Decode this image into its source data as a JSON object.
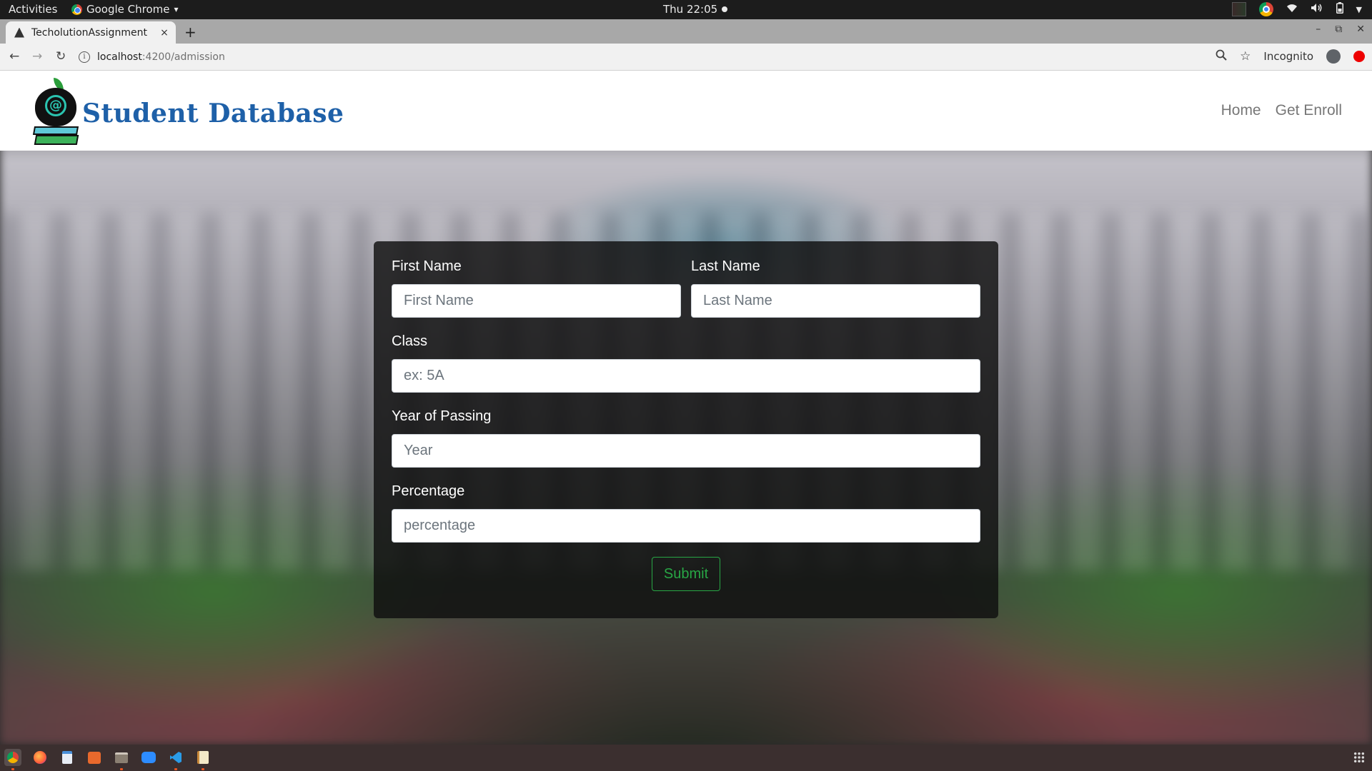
{
  "system_bar": {
    "activities": "Activities",
    "app_name": "Google Chrome",
    "app_menu_arrow": "▾",
    "clock": "Thu 22:05",
    "tray_icons": [
      "screen-thumbnail-icon",
      "chrome-icon",
      "wifi-icon",
      "volume-icon",
      "battery-icon",
      "system-menu-arrow-icon"
    ]
  },
  "browser": {
    "tab_title": "TecholutionAssignment",
    "tab_close": "×",
    "new_tab": "+",
    "window_controls": [
      "–",
      "⧉",
      "✕"
    ],
    "url_host": "localhost",
    "url_path": ":4200/admission",
    "incognito_label": "Incognito"
  },
  "navbar": {
    "brand": "Student Database",
    "links": [
      "Home",
      "Get Enroll"
    ]
  },
  "form": {
    "first_name": {
      "label": "First Name",
      "placeholder": "First Name",
      "value": ""
    },
    "last_name": {
      "label": "Last Name",
      "placeholder": "Last Name",
      "value": ""
    },
    "class": {
      "label": "Class",
      "placeholder": "ex: 5A",
      "value": ""
    },
    "year": {
      "label": "Year of Passing",
      "placeholder": "Year",
      "value": ""
    },
    "percentage": {
      "label": "Percentage",
      "placeholder": "percentage",
      "value": ""
    },
    "submit_label": "Submit"
  },
  "colors": {
    "brand_text": "#1e60a8",
    "submit_accent": "#28a745",
    "card_bg": "rgba(15,15,15,0.82)",
    "taskbar_bg": "#3b2f2f"
  },
  "taskbar_apps": [
    "chrome-icon",
    "firefox-icon",
    "files-doc-icon",
    "software-store-icon",
    "file-manager-icon",
    "zoom-icon",
    "vscode-icon",
    "text-editor-icon"
  ]
}
